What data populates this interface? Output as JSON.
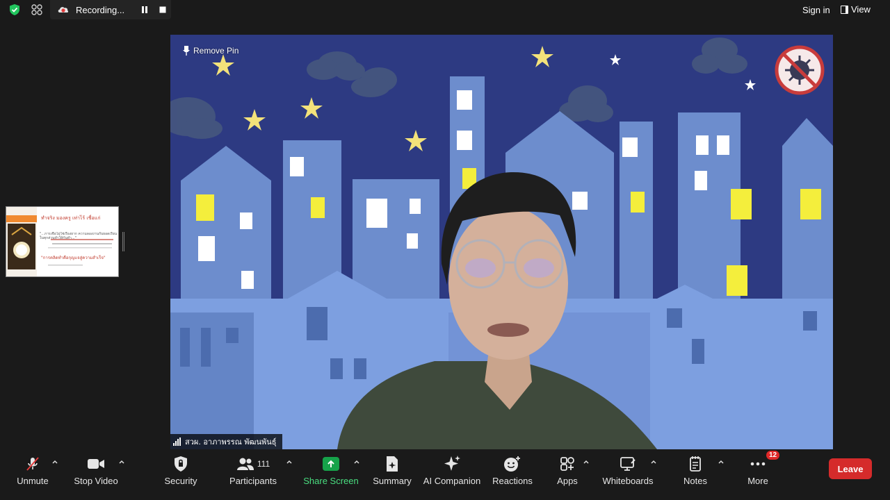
{
  "topbar": {
    "recording_label": "Recording...",
    "sign_in": "Sign in",
    "view": "View"
  },
  "video": {
    "remove_pin": "Remove Pin",
    "participant_name": "สวผ. อาภาพรรณ พัฒนพันธุ์"
  },
  "thumbnail": {
    "title": "ทำจริง มองครู เท่าไร้ เชื่อแก่",
    "quote": "\"...การเชื่อไม่ใช่เรื่องยาก ความลองงานกับยอดเรียนในทุกส่วนทำให้กันทำ...\"",
    "footer": "\"การคลิดทำคือกุญแจสู่ความสำเร็จ\""
  },
  "toolbar": {
    "unmute": "Unmute",
    "stop_video": "Stop Video",
    "security": "Security",
    "participants": "Participants",
    "participants_count": "111",
    "share_screen": "Share Screen",
    "summary": "Summary",
    "ai_companion": "AI Companion",
    "reactions": "Reactions",
    "apps": "Apps",
    "whiteboards": "Whiteboards",
    "notes": "Notes",
    "more": "More",
    "more_badge": "12",
    "leave": "Leave"
  },
  "colors": {
    "accent_green": "#16a34a",
    "leave_red": "#d52b2b",
    "night_sky": "#2d3a82",
    "building_blue": "#6d8dcd"
  }
}
